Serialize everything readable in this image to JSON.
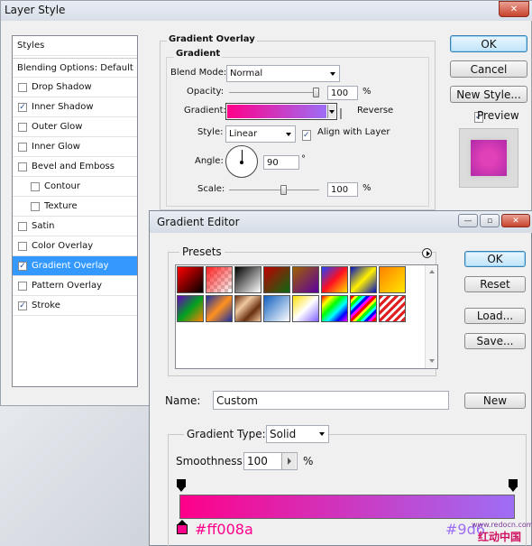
{
  "layer_style": {
    "title": "Layer Style",
    "styles_header": "Styles",
    "blending": "Blending Options: Default",
    "items": [
      {
        "label": "Drop Shadow",
        "checked": false
      },
      {
        "label": "Inner Shadow",
        "checked": true
      },
      {
        "label": "Outer Glow",
        "checked": false
      },
      {
        "label": "Inner Glow",
        "checked": false
      },
      {
        "label": "Bevel and Emboss",
        "checked": false
      },
      {
        "label": "Contour",
        "checked": false
      },
      {
        "label": "Texture",
        "checked": false
      },
      {
        "label": "Satin",
        "checked": false
      },
      {
        "label": "Color Overlay",
        "checked": false
      },
      {
        "label": "Gradient Overlay",
        "checked": true
      },
      {
        "label": "Pattern Overlay",
        "checked": false
      },
      {
        "label": "Stroke",
        "checked": true
      }
    ],
    "group_title": "Gradient Overlay",
    "sub_title": "Gradient",
    "blend_mode_label": "Blend Mode:",
    "blend_mode_value": "Normal",
    "opacity_label": "Opacity:",
    "opacity_value": "100",
    "opacity_level": 1.0,
    "percent": "%",
    "gradient_label": "Gradient:",
    "reverse_label": "Reverse",
    "style_label": "Style:",
    "style_value": "Linear",
    "align_label": "Align with Layer",
    "angle_label": "Angle:",
    "angle_value": "90",
    "degree": "°",
    "scale_label": "Scale:",
    "scale_value": "100",
    "scale_level": 1.0,
    "ok": "OK",
    "cancel": "Cancel",
    "new_style": "New Style...",
    "preview_label": "Preview",
    "close_glyph": "✕"
  },
  "gradient_editor": {
    "title": "Gradient Editor",
    "presets_label": "Presets",
    "ok": "OK",
    "reset": "Reset",
    "load": "Load...",
    "save": "Save...",
    "name_label": "Name:",
    "name_value": "Custom",
    "new": "New",
    "type_label": "Gradient Type:",
    "type_value": "Solid",
    "smooth_label": "Smoothness:",
    "smooth_value": "100",
    "percent": "%",
    "color_start": "#ff008a",
    "color_end": "#9d6",
    "minimize_glyph": "—",
    "restore_glyph": "▫",
    "close_glyph": "✕"
  },
  "watermark": {
    "text1": "www.redocn.com",
    "text2": "红动中国"
  },
  "colors": {
    "accent_selected": "#3399ff",
    "gradient_pink": "#ff008a",
    "gradient_purple": "#9d6ef5"
  }
}
